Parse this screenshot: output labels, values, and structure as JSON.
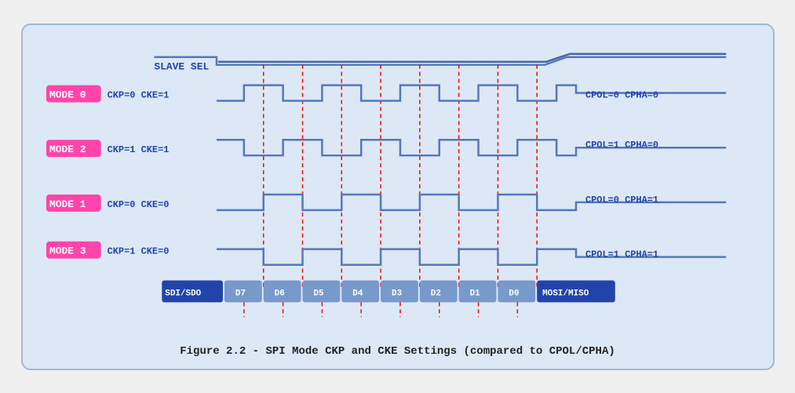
{
  "caption": "Figure 2.2 - SPI Mode CKP and CKE Settings (compared to CPOL/CPHA)",
  "diagram": {
    "slave_sel_label": "SLAVE SEL",
    "modes": [
      {
        "label": "MODE 0",
        "params": "CKP=0  CKE=1",
        "right": "CPOL=0  CPHA=0"
      },
      {
        "label": "MODE 2",
        "params": "CKP=1  CKE=1",
        "right": "CPOL=1  CPHA=0"
      },
      {
        "label": "MODE 1",
        "params": "CKP=0  CKE=0",
        "right": "CPOL=0  CPHA=1"
      },
      {
        "label": "MODE 3",
        "params": "CKP=1  CKE=0",
        "right": "CPOL=1  CPHA=1"
      }
    ],
    "data_labels": [
      "SDI/SDO",
      "D7",
      "D6",
      "D5",
      "D4",
      "D3",
      "D2",
      "D1",
      "D0",
      "MOSI/MISO"
    ]
  }
}
